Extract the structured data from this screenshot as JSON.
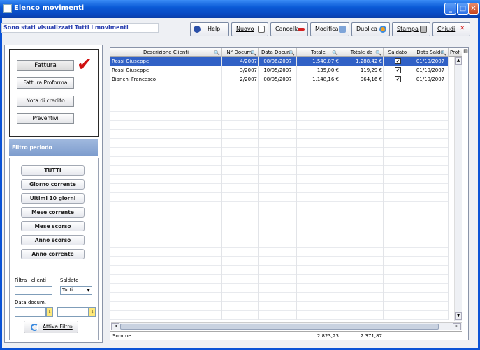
{
  "window": {
    "title": "Elenco movimenti",
    "min": "_",
    "max": "□",
    "close": "✕"
  },
  "message": "Sono stati visualizzati Tutti i movimenti",
  "toolbar": {
    "help": "Help",
    "nuovo": "Nuovo",
    "cancella": "Cancella",
    "modifica": "Modifica",
    "duplica": "Duplica",
    "stampa": "Stampa",
    "chiudi": "Chiudi"
  },
  "docs": {
    "fattura": "Fattura",
    "proforma": "Fattura Proforma",
    "nota": "Nota di credito",
    "preventivi": "Preventivi",
    "checkmark": "✔"
  },
  "filtro": {
    "header": "Filtro periodo",
    "tutti": "TUTTI",
    "giorno": "Giorno corrente",
    "ultimi10": "Ultimi 10 giorni",
    "mese": "Mese corrente",
    "scorso": "Mese scorso",
    "anno_scorso": "Anno scorso",
    "anno": "Anno corrente",
    "filtra_label": "Filtra i clienti",
    "saldato_label": "Saldato",
    "saldato_value": "Tutti",
    "data_label": "Data docum.",
    "attiva": "Attiva Filtro",
    "calendar_glyph": "⇩",
    "dropdown_glyph": "▼"
  },
  "columns": {
    "cliente": "Descrizione Clienti",
    "num": "N° Docum.",
    "data": "Data Docum.",
    "totale": "Totale",
    "totale_da": "Totale da",
    "saldato": "Saldato",
    "data_saldo": "Data Saldo",
    "prof": "Prof",
    "search_glyph": "🔍",
    "col_menu_glyph": "▤"
  },
  "rows": [
    {
      "cliente": "Rossi Giuseppe",
      "num": "4/2007",
      "data": "08/06/2007",
      "totale": "1.540,07 €",
      "totale_da": "1.288,42 €",
      "saldato": "✓",
      "data_saldo": "01/10/2007"
    },
    {
      "cliente": "Rossi Giuseppe",
      "num": "3/2007",
      "data": "10/05/2007",
      "totale": "135,00 €",
      "totale_da": "119,29 €",
      "saldato": "✓",
      "data_saldo": "01/10/2007"
    },
    {
      "cliente": "Bianchi Francesco",
      "num": "2/2007",
      "data": "08/05/2007",
      "totale": "1.148,16 €",
      "totale_da": "964,16 €",
      "saldato": "✓",
      "data_saldo": "01/10/2007"
    }
  ],
  "footer": {
    "somme": "Somme",
    "totale": "2.823,23",
    "totale_da": "2.371,87"
  },
  "scroll": {
    "up": "▲",
    "down": "▼",
    "left": "◄",
    "right": "►"
  },
  "colors": {
    "accent": "#0a52d6",
    "selection": "#3161c6"
  }
}
